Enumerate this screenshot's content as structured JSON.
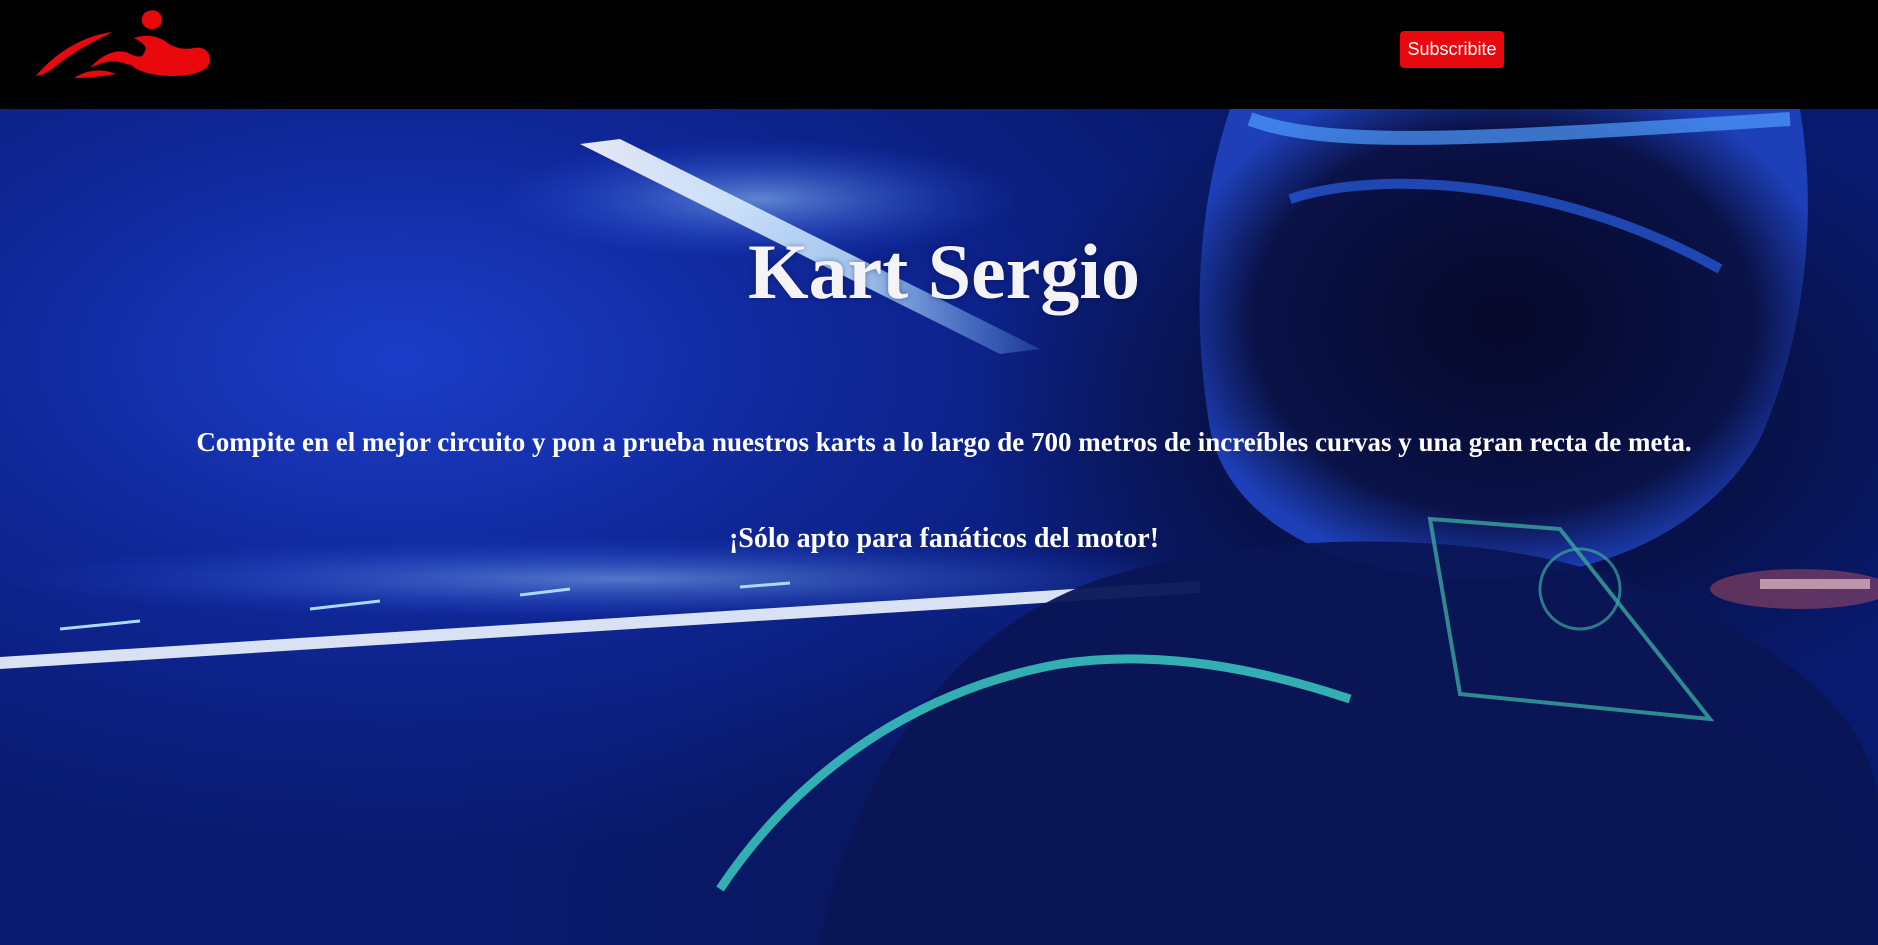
{
  "header": {
    "logo_icon": "kart-logo-icon",
    "subscribe_label": "Subscribite",
    "accent_color": "#e8080e"
  },
  "hero": {
    "title": "Kart Sergio",
    "description": "Compite en el mejor circuito y pon a prueba nuestros karts a lo largo de 700 metros de increíbles curvas y una gran recta de meta.",
    "tagline": "¡Sólo apto para fanáticos del motor!",
    "background_icon": "racing-helmet-video-background"
  }
}
